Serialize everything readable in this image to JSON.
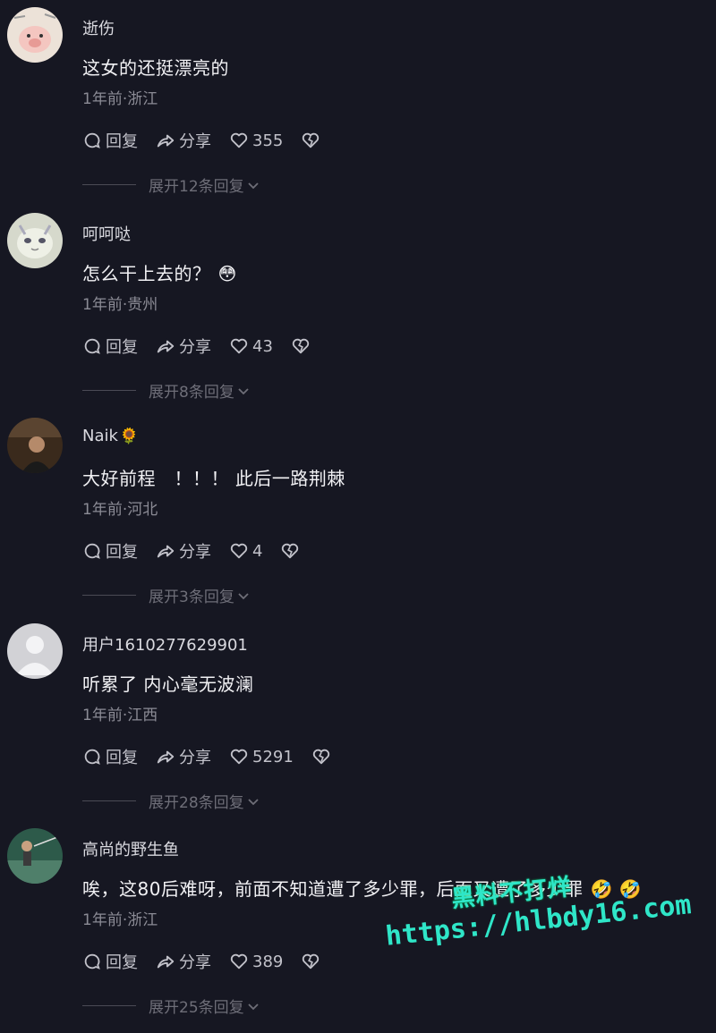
{
  "labels": {
    "reply": "回复",
    "share": "分享"
  },
  "comments": [
    {
      "user": "逝伤",
      "text": "这女的还挺漂亮的",
      "emoji": "",
      "meta": "1年前·浙江",
      "likes": "355",
      "expand": "展开12条回复",
      "avatar": "cartoon-pig-avatar",
      "avatar_color": "#e9dcd0"
    },
    {
      "user": "呵呵哒",
      "text": "怎么干上去的？",
      "emoji": "😳",
      "meta": "1年前·贵州",
      "likes": "43",
      "expand": "展开8条回复",
      "avatar": "cat-face-avatar",
      "avatar_color": "#cfd3c6"
    },
    {
      "user": "Naik",
      "user_badge": "🌻",
      "text": "大好前程　！！！ 此后一路荆棘",
      "emoji": "",
      "meta": "1年前·河北",
      "likes": "4",
      "expand": "展开3条回复",
      "avatar": "person-photo-avatar",
      "avatar_color": "#3a2a1c"
    },
    {
      "user": "用户1610277629901",
      "text": "听累了  内心毫无波澜",
      "emoji": "",
      "meta": "1年前·江西",
      "likes": "5291",
      "expand": "展开28条回复",
      "avatar": "default-user-avatar",
      "avatar_color": "#d0d0d4"
    },
    {
      "user": "高尚的野生鱼",
      "text": "唉，这80后难呀，前面不知道遭了多少罪，后面又遭了多少罪",
      "emoji": "🤣 🤣",
      "meta": "1年前·浙江",
      "likes": "389",
      "expand": "展开25条回复",
      "avatar": "fisherman-photo-avatar",
      "avatar_color": "#2d5a4a"
    }
  ],
  "watermark": {
    "line1": "黑料不打烊",
    "line2": "https://hlbdy16.com",
    "color": "#2fe6c8"
  }
}
